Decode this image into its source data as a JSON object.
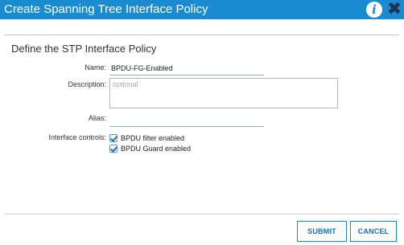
{
  "dialog": {
    "title": "Create Spanning Tree Interface Policy",
    "info_icon": "i",
    "close_icon": "✖"
  },
  "form": {
    "section_title": "Define the STP Interface Policy",
    "name": {
      "label": "Name:",
      "value": "BPDU-FG-Enabled"
    },
    "description": {
      "label": "Description:",
      "placeholder": "optional",
      "value": ""
    },
    "alias": {
      "label": "Alias:",
      "value": ""
    },
    "interface_controls": {
      "label": "Interface controls:",
      "options": [
        {
          "label": "BPDU filter enabled",
          "checked": true
        },
        {
          "label": "BPDU Guard enabled",
          "checked": true
        }
      ]
    }
  },
  "buttons": {
    "submit": "SUBMIT",
    "cancel": "CANCEL"
  },
  "colors": {
    "titlebar": "#1a8bd1",
    "accent": "#1a6fb4"
  }
}
